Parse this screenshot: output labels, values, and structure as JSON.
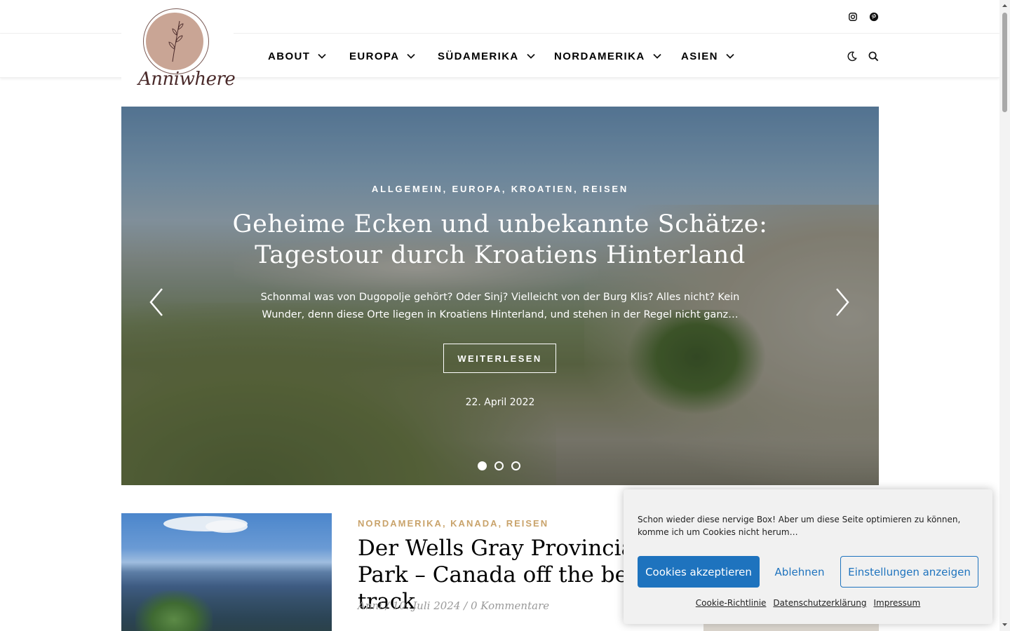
{
  "site": {
    "logo_text": "Anniwhere"
  },
  "social": {
    "instagram_icon": "instagram-icon",
    "pinterest_icon": "pinterest-icon"
  },
  "nav": {
    "items": [
      {
        "label": "ABOUT"
      },
      {
        "label": "EUROPA"
      },
      {
        "label": "SÜDAMERIKA"
      },
      {
        "label": "NORDAMERIKA"
      },
      {
        "label": "ASIEN"
      }
    ],
    "dark_mode_icon": "moon-icon",
    "search_icon": "search-icon"
  },
  "hero": {
    "categories": "ALLGEMEIN, EUROPA, KROATIEN, REISEN",
    "title": "Geheime Ecken und unbekannte Schätze: Tagestour durch Kroatiens Hinterland",
    "excerpt": "Schonmal was von Dugopolje gehört? Oder Sinj? Vielleicht von der Burg Klis? Alles nicht? Kein Wunder, denn diese Orte liegen in Kroatiens Hinterland, und stehen in der Regel nicht ganz…",
    "button_label": "WEITERLESEN",
    "date": "22. April 2022",
    "slides_count": 3,
    "active_slide": 1
  },
  "post": {
    "categories": "NORDAMERIKA, KANADA, REISEN",
    "title": "Der Wells Gray Provincial Park – Canada off the beaten track",
    "meta": "Anni / 10. Juli 2024 / 0 Kommentare"
  },
  "cookie": {
    "message": "Schon wieder diese nervige Box! Aber um diese Seite optimieren zu können, komme ich um Cookies nicht herum…",
    "accept_label": "Cookies akzeptieren",
    "deny_label": "Ablehnen",
    "settings_label": "Einstellungen anzeigen",
    "links": [
      "Cookie-Richtlinie",
      "Datenschutzerklärung",
      "Impressum"
    ],
    "accent_color": "#1e73be"
  }
}
